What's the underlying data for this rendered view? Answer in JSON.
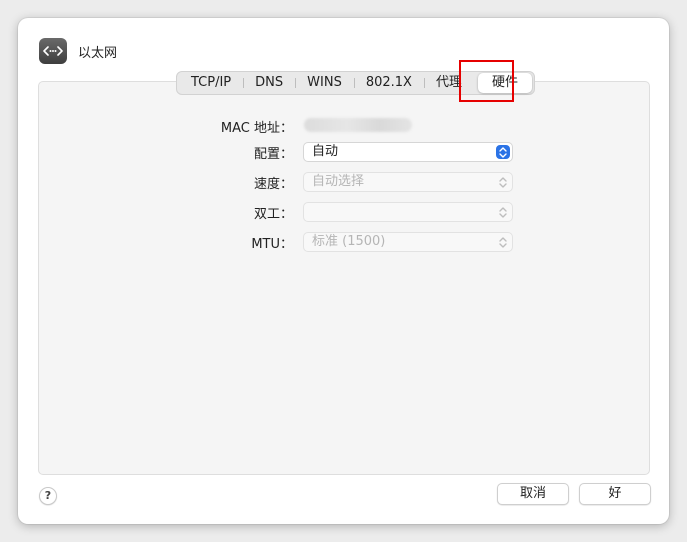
{
  "window": {
    "title": "以太网"
  },
  "tabs": [
    {
      "label": "TCP/IP"
    },
    {
      "label": "DNS"
    },
    {
      "label": "WINS"
    },
    {
      "label": "802.1X"
    },
    {
      "label": "代理"
    },
    {
      "label": "硬件",
      "selected": true
    }
  ],
  "form": {
    "mac": {
      "label": "MAC 地址："
    },
    "config": {
      "label": "配置：",
      "value": "自动"
    },
    "speed": {
      "label": "速度：",
      "value": "自动选择"
    },
    "duplex": {
      "label": "双工：",
      "value": ""
    },
    "mtu": {
      "label": "MTU：",
      "value": "标准 (1500)"
    }
  },
  "footer": {
    "help_label": "?",
    "cancel_label": "取消",
    "ok_label": "好"
  },
  "colors": {
    "accent": "#2b73e6",
    "highlight": "#e60000"
  },
  "icons": {
    "app": "ethernet-icon",
    "stepper": "up-down-chevron-icon"
  }
}
